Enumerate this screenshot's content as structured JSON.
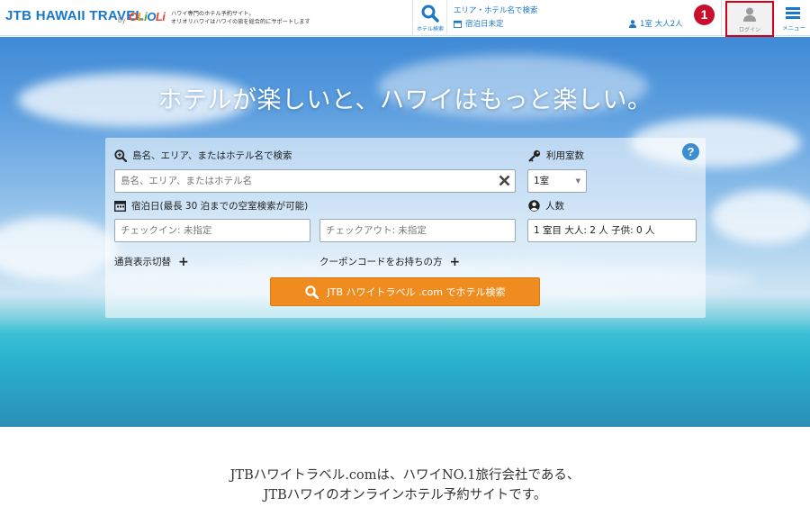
{
  "header": {
    "logo_text": "JTB HAWAII TRAVEL",
    "logo_by": "by",
    "logo_brand": [
      "O",
      "L",
      "i",
      "O",
      "L",
      "i"
    ],
    "tagline_line1": "ハワイ専門のホテル予約サイト。",
    "tagline_line2": "オリオリハワイはハワイの旅を総合的にサポートします",
    "search_icon_label": "ホテル検索",
    "area_text": "エリア・ホテル名で検索",
    "date_text": "宿泊日未定",
    "guests_text": "1室 大人2人",
    "badge_number": "1",
    "login_label": "ログイン",
    "menu_label": "メニュー"
  },
  "hero": {
    "title": "ホテルが楽しいと、ハワイはもっと楽しい。"
  },
  "search_form": {
    "keyword_label": "島名、エリア、またはホテル名で検索",
    "keyword_placeholder": "島名、エリア、またはホテル名",
    "rooms_label": "利用室数",
    "rooms_value": "1室",
    "dates_label": "宿泊日(最長 30 泊までの空室検索が可能)",
    "checkin_placeholder": "チェックイン: 未指定",
    "checkout_placeholder": "チェックアウト: 未指定",
    "guests_label": "人数",
    "guests_value": "1 室目 大人: 2 人 子供: 0 人",
    "currency_toggle": "通貨表示切替",
    "coupon_toggle": "クーポンコードをお持ちの方",
    "help_label": "?",
    "search_button": "JTB ハワイトラベル .com でホテル検索"
  },
  "intro": {
    "line1": "JTBハワイトラベル.comは、ハワイNO.1旅行会社である、",
    "line2": "JTBハワイのオンラインホテル予約サイトです。"
  },
  "colors": {
    "brand_blue": "#1a77c9",
    "accent_orange": "#ef8c1f",
    "badge_red": "#c8102e"
  }
}
